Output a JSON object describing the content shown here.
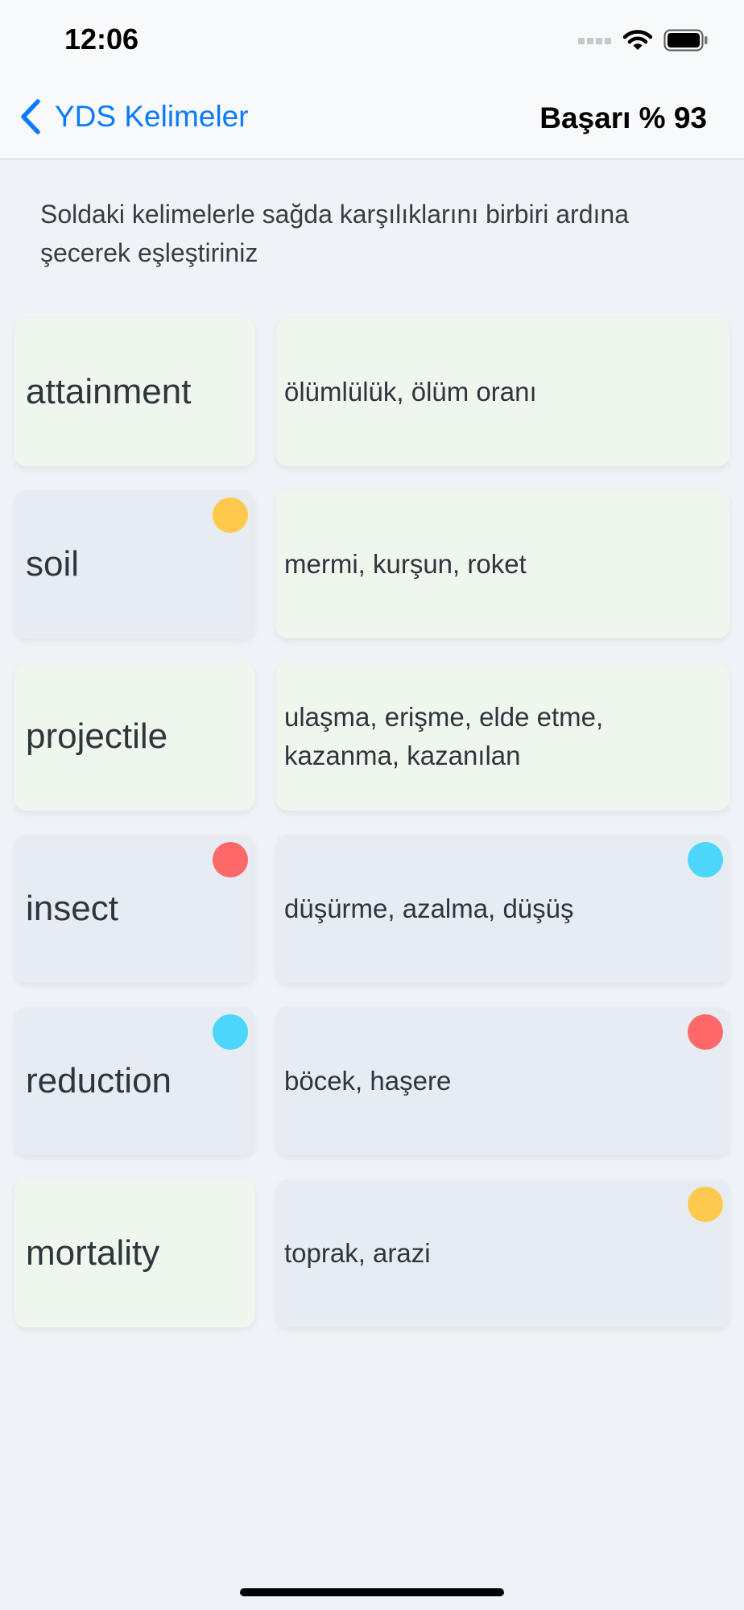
{
  "status_bar": {
    "time": "12:06"
  },
  "nav": {
    "back_label": "YDS Kelimeler",
    "score": "Başarı % 93"
  },
  "instructions": "Soldaki kelimelerle sağda karşılıklarını birbiri ardına şecerek eşleştiriniz",
  "colors": {
    "accent": "#0a7aff",
    "green_card": "#eef6ee",
    "gray_card": "#e7ecf3",
    "yellow": "#ffc94d",
    "red": "#ff6868",
    "blue": "#4dd6fb"
  },
  "rows": [
    {
      "word": "attainment",
      "word_state": "green",
      "word_dot": null,
      "meaning": "ölümlülük, ölüm oranı",
      "meaning_state": "green",
      "meaning_dot": null
    },
    {
      "word": "soil",
      "word_state": "gray",
      "word_dot": "yellow",
      "meaning": "mermi, kurşun, roket",
      "meaning_state": "green",
      "meaning_dot": null
    },
    {
      "word": "projectile",
      "word_state": "green",
      "word_dot": null,
      "meaning": "ulaşma, erişme, elde etme, kazanma, kazanılan",
      "meaning_state": "green",
      "meaning_dot": null
    },
    {
      "word": "insect",
      "word_state": "gray",
      "word_dot": "red",
      "meaning": "düşürme, azalma, düşüş",
      "meaning_state": "gray",
      "meaning_dot": "blue"
    },
    {
      "word": "reduction",
      "word_state": "gray",
      "word_dot": "blue",
      "meaning": "böcek, haşere",
      "meaning_state": "gray",
      "meaning_dot": "red"
    },
    {
      "word": "mortality",
      "word_state": "green",
      "word_dot": null,
      "meaning": "toprak, arazi",
      "meaning_state": "gray",
      "meaning_dot": "yellow"
    }
  ]
}
